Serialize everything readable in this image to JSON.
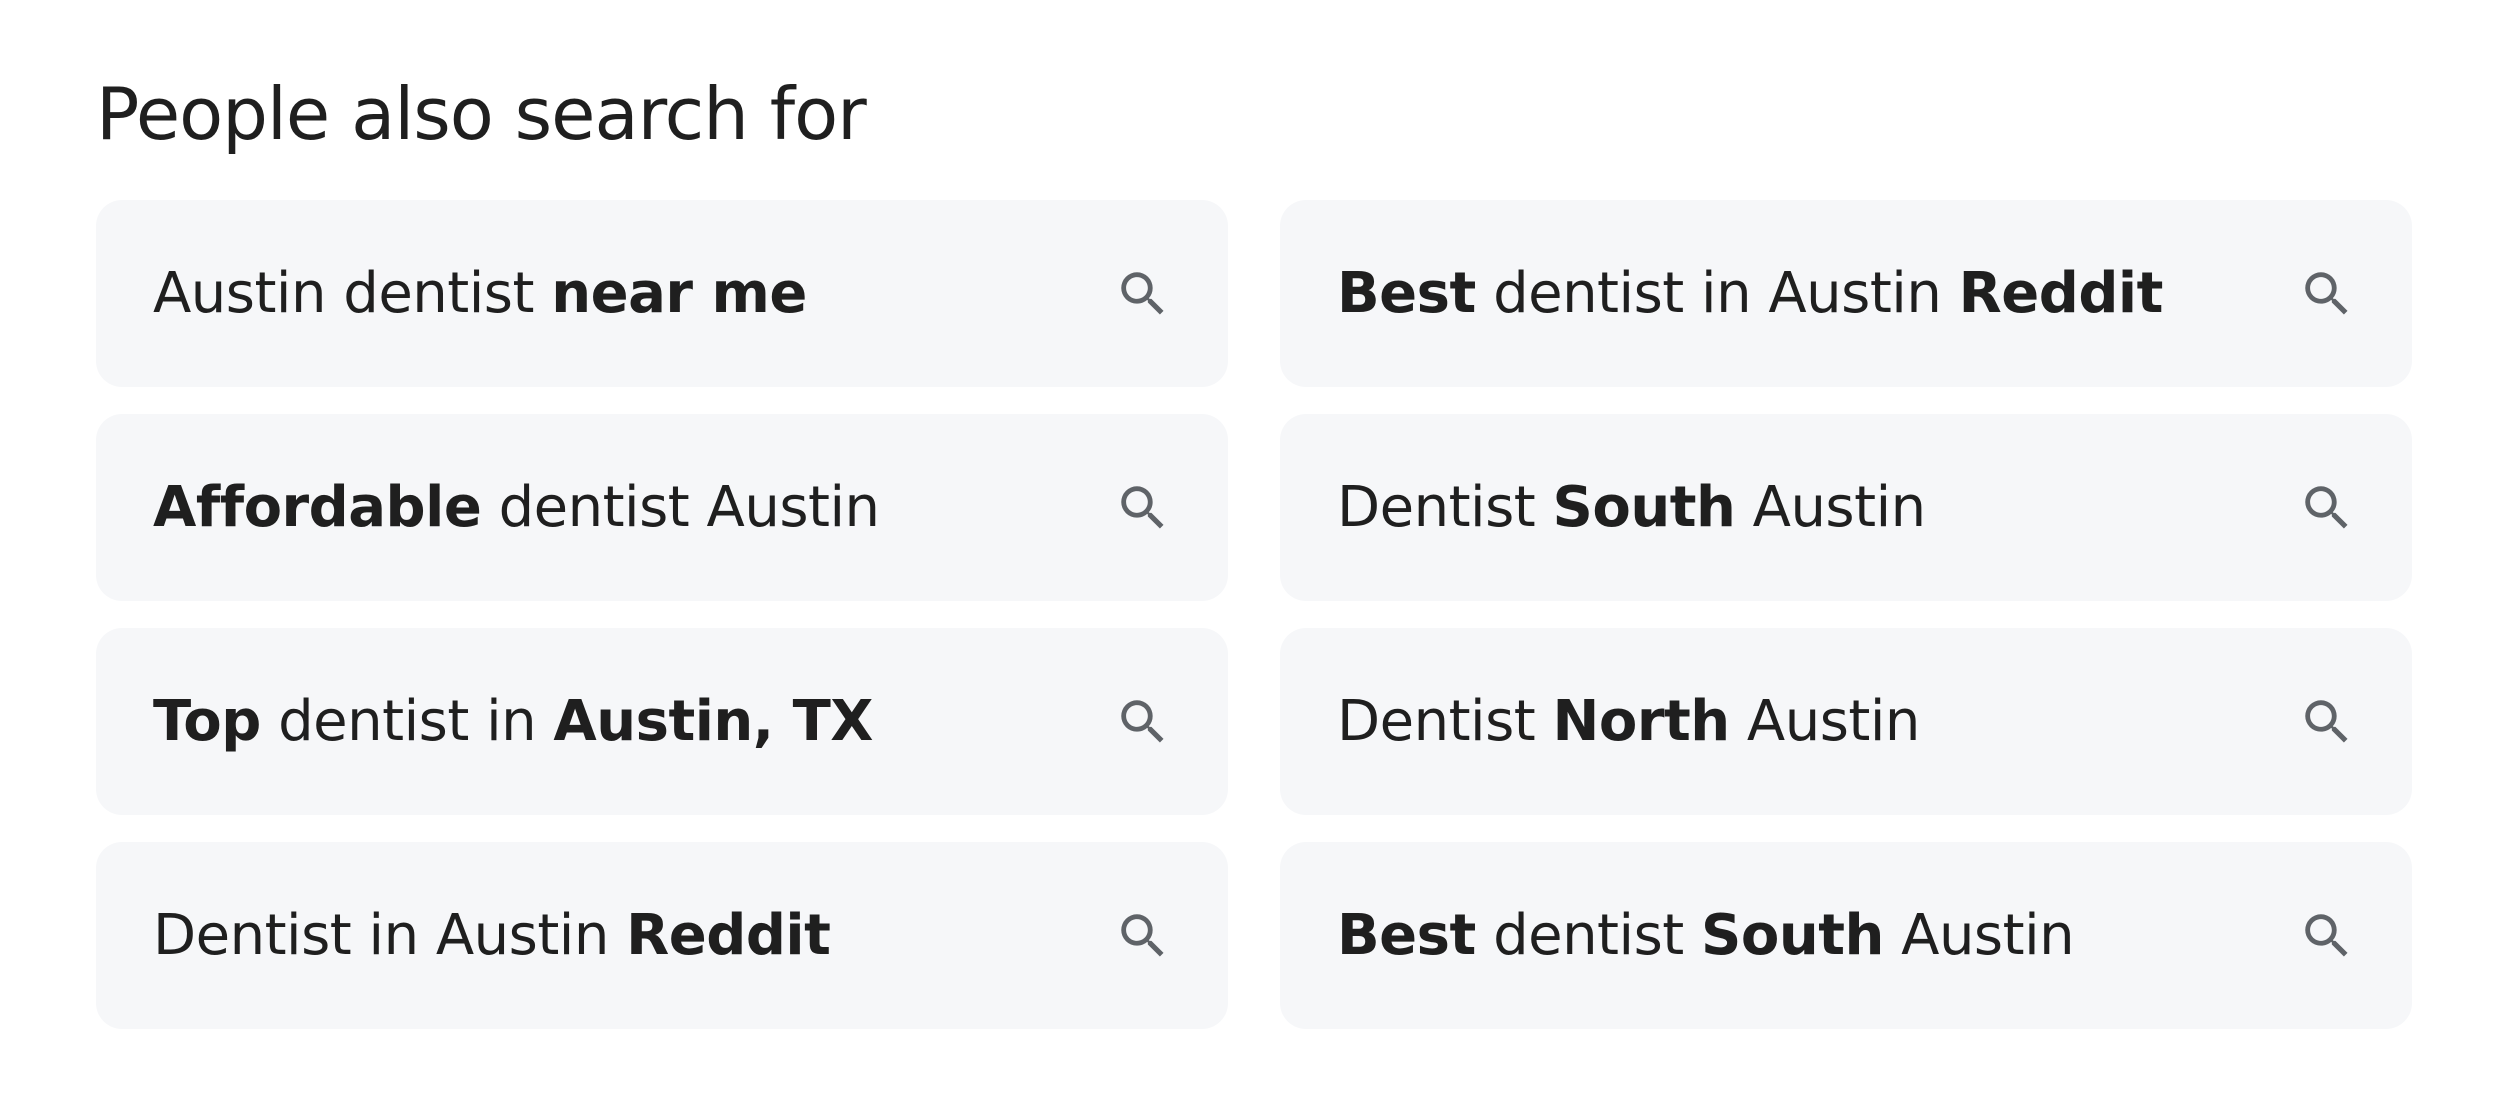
{
  "section": {
    "title": "People also search for"
  },
  "colors": {
    "chip_background": "#f6f7f9",
    "text": "#1f1f1f",
    "icon": "#5f6368"
  },
  "icons": {
    "search": "search-icon"
  },
  "suggestions": [
    {
      "label": "Austin dentist near me",
      "parts": [
        {
          "text": "Austin dentist ",
          "bold": false
        },
        {
          "text": "near me",
          "bold": true
        }
      ]
    },
    {
      "label": "Best dentist in Austin Reddit",
      "parts": [
        {
          "text": "Best",
          "bold": true
        },
        {
          "text": " dentist in Austin ",
          "bold": false
        },
        {
          "text": "Reddit",
          "bold": true
        }
      ]
    },
    {
      "label": "Affordable dentist Austin",
      "parts": [
        {
          "text": "Affordable",
          "bold": true
        },
        {
          "text": " dentist Austin",
          "bold": false
        }
      ]
    },
    {
      "label": "Dentist South Austin",
      "parts": [
        {
          "text": "Dentist ",
          "bold": false
        },
        {
          "text": "South",
          "bold": true
        },
        {
          "text": " Austin",
          "bold": false
        }
      ]
    },
    {
      "label": "Top dentist in Austin, TX",
      "parts": [
        {
          "text": "Top",
          "bold": true
        },
        {
          "text": " dentist in ",
          "bold": false
        },
        {
          "text": "Austin, TX",
          "bold": true
        }
      ]
    },
    {
      "label": "Dentist North Austin",
      "parts": [
        {
          "text": "Dentist ",
          "bold": false
        },
        {
          "text": "North",
          "bold": true
        },
        {
          "text": " Austin",
          "bold": false
        }
      ]
    },
    {
      "label": "Dentist in Austin Reddit",
      "parts": [
        {
          "text": "Dentist in Austin ",
          "bold": false
        },
        {
          "text": "Reddit",
          "bold": true
        }
      ]
    },
    {
      "label": "Best dentist South Austin",
      "parts": [
        {
          "text": "Best",
          "bold": true
        },
        {
          "text": " dentist ",
          "bold": false
        },
        {
          "text": "South",
          "bold": true
        },
        {
          "text": " Austin",
          "bold": false
        }
      ]
    }
  ]
}
